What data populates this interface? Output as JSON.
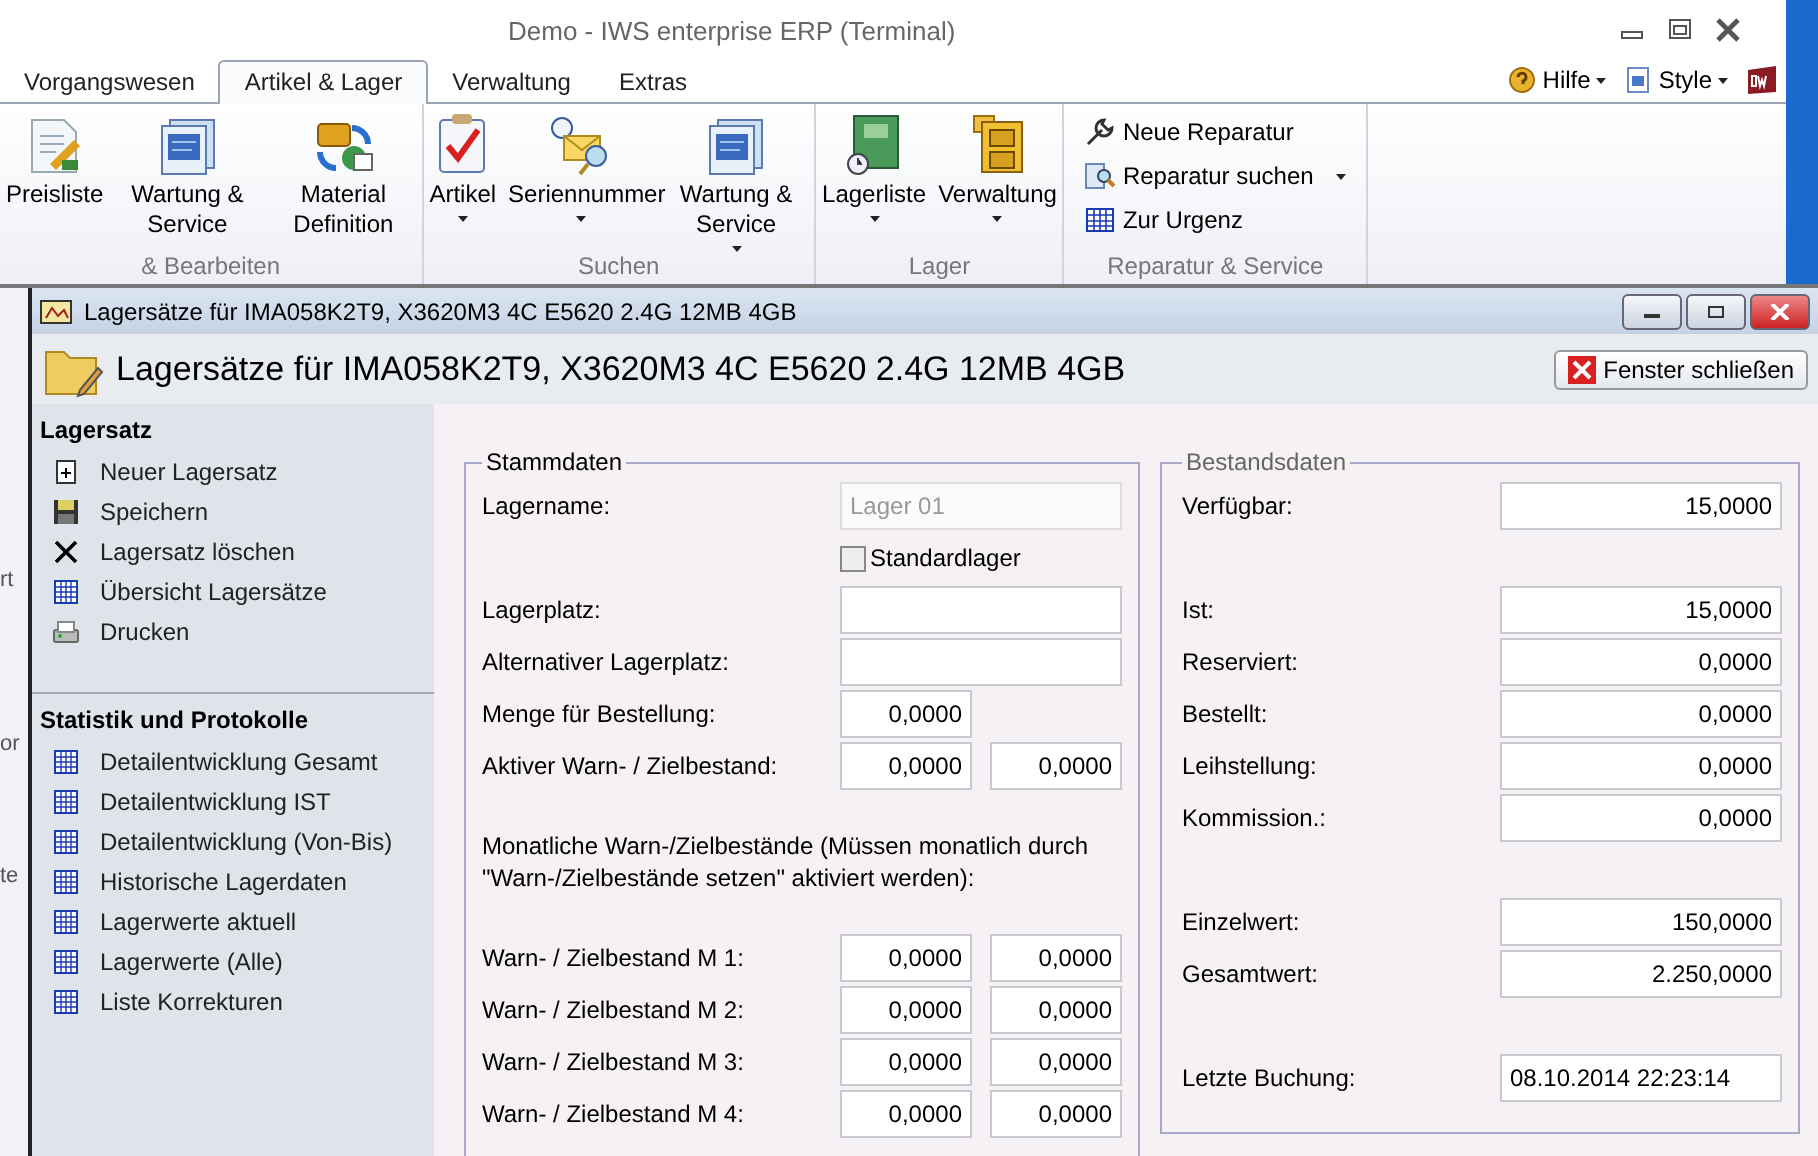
{
  "window": {
    "title": "Demo - IWS enterprise ERP (Terminal)"
  },
  "menu_tabs": [
    {
      "label": "Vorgangswesen",
      "selected": false
    },
    {
      "label": "Artikel & Lager",
      "selected": true
    },
    {
      "label": "Verwaltung",
      "selected": false
    },
    {
      "label": "Extras",
      "selected": false
    }
  ],
  "menu_right": [
    {
      "label": "Hilfe",
      "dropdown": true
    },
    {
      "label": "Style",
      "dropdown": true
    }
  ],
  "ribbon": {
    "groups": [
      {
        "label": "& Bearbeiten",
        "buttons": [
          {
            "kind": "large",
            "label": "Preisliste",
            "dropdown": false
          },
          {
            "kind": "large",
            "label": "Wartung & Service",
            "dropdown": false
          },
          {
            "kind": "large",
            "label": "Material Definition",
            "dropdown": false
          }
        ]
      },
      {
        "label": "Suchen",
        "buttons": [
          {
            "kind": "large",
            "label": "Artikel",
            "dropdown": true
          },
          {
            "kind": "large",
            "label": "Seriennummer",
            "dropdown": true
          },
          {
            "kind": "large",
            "label": "Wartung & Service",
            "dropdown": true
          }
        ]
      },
      {
        "label": "Lager",
        "buttons": [
          {
            "kind": "large",
            "label": "Lagerliste",
            "dropdown": true
          },
          {
            "kind": "large",
            "label": "Verwaltung",
            "dropdown": true
          }
        ]
      },
      {
        "label": "Reparatur & Service",
        "buttons": [
          {
            "kind": "small",
            "label": "Neue Reparatur",
            "dropdown": false
          },
          {
            "kind": "small",
            "label": "Reparatur suchen",
            "dropdown": true
          },
          {
            "kind": "small",
            "label": "Zur Urgenz",
            "dropdown": false
          }
        ]
      }
    ]
  },
  "background_texts": [
    "rt",
    "or",
    "te"
  ],
  "child": {
    "title": "Lagersätze für IMA058K2T9, X3620M3 4C E5620 2.4G 12MB 4GB",
    "heading": "Lagersätze für IMA058K2T9, X3620M3 4C E5620 2.4G 12MB 4GB",
    "close_button": "Fenster schließen"
  },
  "sidebar": {
    "sections": [
      {
        "title": "Lagersatz",
        "items": [
          {
            "label": "Neuer Lagersatz"
          },
          {
            "label": "Speichern"
          },
          {
            "label": "Lagersatz löschen"
          },
          {
            "label": "Übersicht Lagersätze"
          },
          {
            "label": "Drucken"
          }
        ]
      },
      {
        "title": "Statistik und Protokolle",
        "items": [
          {
            "label": "Detailentwicklung Gesamt"
          },
          {
            "label": "Detailentwicklung IST"
          },
          {
            "label": "Detailentwicklung (Von-Bis)"
          },
          {
            "label": "Historische Lagerdaten"
          },
          {
            "label": "Lagerwerte aktuell"
          },
          {
            "label": "Lagerwerte (Alle)"
          },
          {
            "label": "Liste Korrekturen"
          }
        ]
      }
    ]
  },
  "stammdaten": {
    "title": "Stammdaten",
    "rows": [
      {
        "kind": "text",
        "label": "Lagername:",
        "value": "Lager 01",
        "disabled": true
      },
      {
        "kind": "checkbox",
        "label": "Standardlager",
        "checked": false
      },
      {
        "kind": "text",
        "label": "Lagerplatz:",
        "disabled": false
      },
      {
        "kind": "text",
        "label": "Alternativer Lagerplatz:",
        "disabled": false
      },
      {
        "kind": "numbers",
        "label": "Menge für Bestellung:",
        "values": [
          "0,0000"
        ]
      },
      {
        "kind": "numbers",
        "label": "Aktiver Warn- / Zielbestand:",
        "values": [
          "0,0000",
          "0,0000"
        ]
      },
      {
        "kind": "note",
        "label": "Monatliche Warn-/Zielbestände (Müssen monatlich durch \"Warn-/Zielbestände setzen\" aktiviert werden):"
      },
      {
        "kind": "numbers",
        "label": "Warn- / Zielbestand M 1:",
        "values": [
          "0,0000",
          "0,0000"
        ]
      },
      {
        "kind": "numbers",
        "label": "Warn- / Zielbestand M 2:",
        "values": [
          "0,0000",
          "0,0000"
        ]
      },
      {
        "kind": "numbers",
        "label": "Warn- / Zielbestand M 3:",
        "values": [
          "0,0000",
          "0,0000"
        ]
      },
      {
        "kind": "numbers",
        "label": "Warn- / Zielbestand M 4:",
        "values": [
          "0,0000",
          "0,0000"
        ]
      }
    ]
  },
  "bestandsdaten": {
    "title": "Bestandsdaten",
    "groups": [
      [
        {
          "label": "Verfügbar:",
          "value": "15,0000"
        }
      ],
      [
        {
          "label": "Ist:",
          "value": "15,0000"
        },
        {
          "label": "Reserviert:",
          "value": "0,0000"
        },
        {
          "label": "Bestellt:",
          "value": "0,0000"
        },
        {
          "label": "Leihstellung:",
          "value": "0,0000"
        },
        {
          "label": "Kommission.:",
          "value": "0,0000"
        }
      ],
      [
        {
          "label": "Einzelwert:",
          "value": "150,0000"
        },
        {
          "label": "Gesamtwert:",
          "value": "2.250,0000"
        }
      ],
      [
        {
          "label": "Letzte Buchung:",
          "value": "08.10.2014 22:23:14",
          "kind": "datetime"
        }
      ]
    ]
  }
}
